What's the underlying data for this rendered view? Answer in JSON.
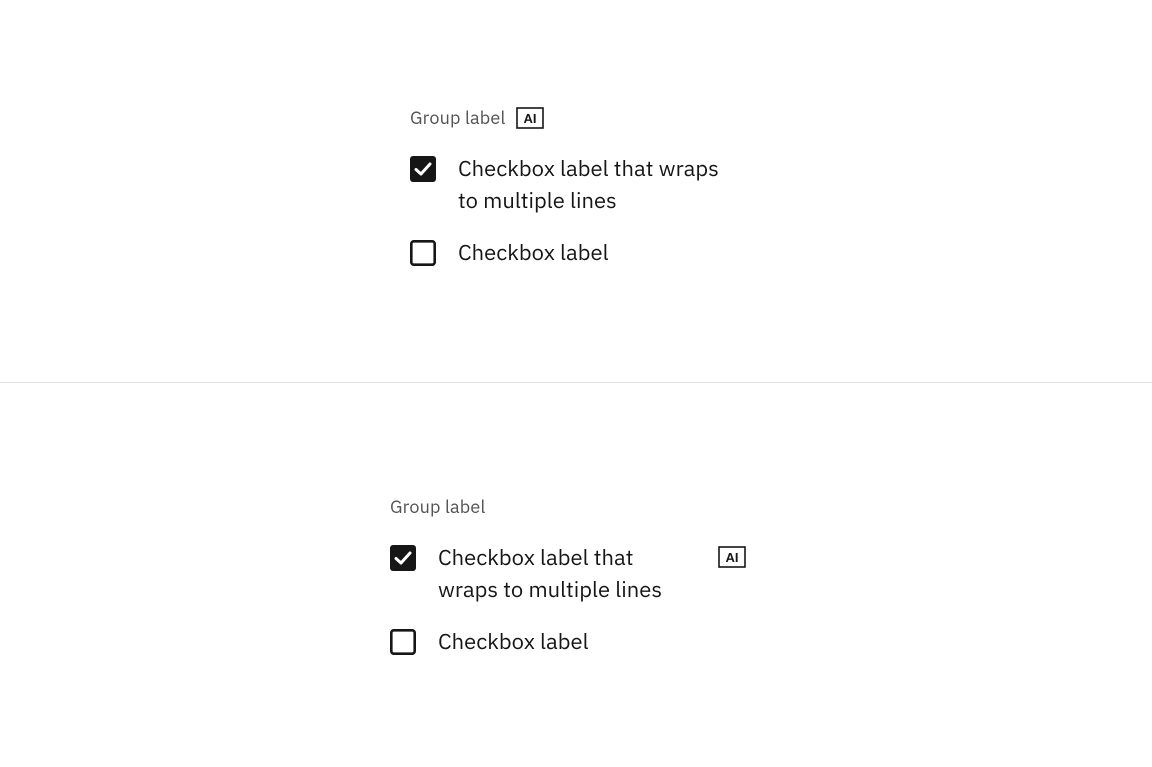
{
  "badge_text": "AI",
  "groups": [
    {
      "label": "Group label",
      "badge_on_group": true,
      "items": [
        {
          "label": "Checkbox label that wraps to multiple lines",
          "checked": true,
          "badge": false
        },
        {
          "label": "Checkbox label",
          "checked": false,
          "badge": false
        }
      ]
    },
    {
      "label": "Group label",
      "badge_on_group": false,
      "items": [
        {
          "label": "Checkbox label that wraps to multiple lines",
          "checked": true,
          "badge": true
        },
        {
          "label": "Checkbox label",
          "checked": false,
          "badge": false
        }
      ]
    }
  ]
}
